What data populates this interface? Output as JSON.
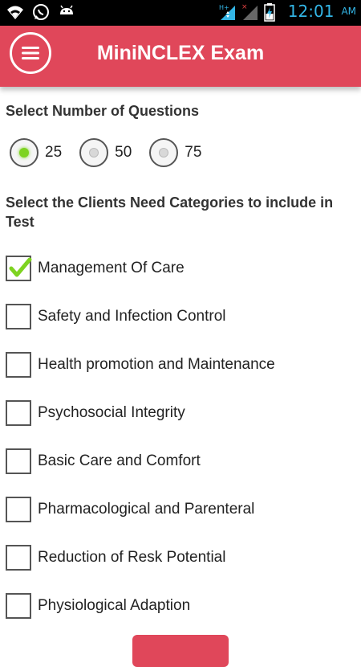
{
  "status_bar": {
    "time": "12:01",
    "ampm": "AM",
    "icons_left": [
      "wifi-icon",
      "whatsapp-icon",
      "android-icon"
    ],
    "icons_right": [
      "data-signal-icon",
      "signal-icon",
      "battery-charging-icon"
    ]
  },
  "header": {
    "title": "MiniNCLEX Exam",
    "menu_icon": "hamburger-icon",
    "color": "#e0475a"
  },
  "questions_section": {
    "title": "Select Number of Questions",
    "options": [
      {
        "label": "25",
        "selected": true
      },
      {
        "label": "50",
        "selected": false
      },
      {
        "label": "75",
        "selected": false
      }
    ]
  },
  "categories_section": {
    "title_line1": "Select the Clients Need Categories to include in",
    "title_line2": "Test",
    "items": [
      {
        "label": "Management Of Care",
        "checked": true
      },
      {
        "label": "Safety and Infection Control",
        "checked": false
      },
      {
        "label": "Health promotion and Maintenance",
        "checked": false
      },
      {
        "label": "Psychosocial Integrity",
        "checked": false
      },
      {
        "label": "Basic Care and Comfort",
        "checked": false
      },
      {
        "label": "Pharmacological and Parenteral",
        "checked": false
      },
      {
        "label": "Reduction of Resk Potential",
        "checked": false
      },
      {
        "label": "Physiological Adaption",
        "checked": false
      }
    ]
  }
}
